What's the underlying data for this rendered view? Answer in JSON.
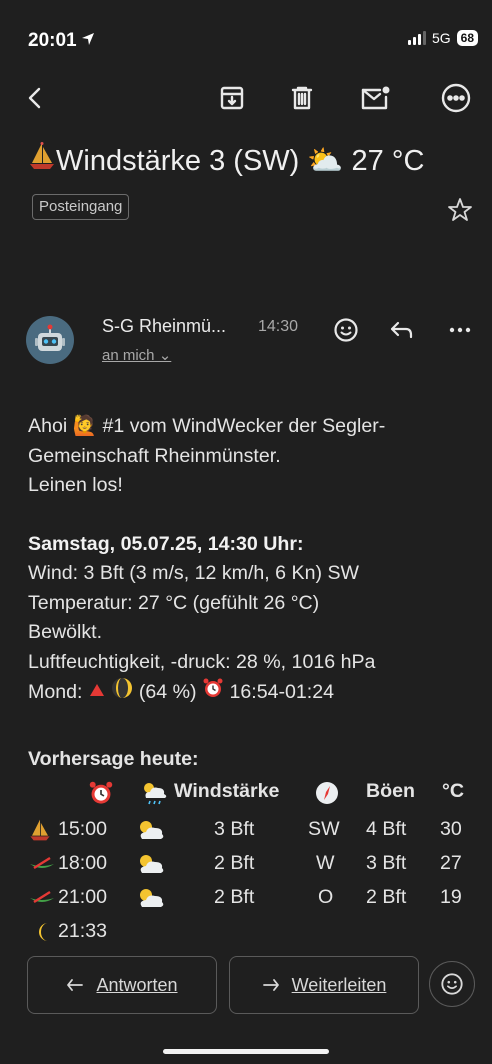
{
  "status": {
    "time": "20:01",
    "network": "5G",
    "battery": "68"
  },
  "subject": {
    "text": "Windstärke 3 (SW) ⛅ 27 °C",
    "label": "Posteingang"
  },
  "sender": {
    "name": "S-G Rheinmü...",
    "time": "14:30",
    "recipient": "an mich"
  },
  "body": {
    "line1": "Ahoi 🙋 #1 vom WindWecker der Segler-",
    "line2": "Gemeinschaft Rheinmünster.",
    "line3": "Leinen los!",
    "heading": "Samstag, 05.07.25, 14:30 Uhr:",
    "wind": "Wind: 3 Bft (3 m/s, 12 km/h, 6 Kn) SW",
    "temp": "Temperatur: 27 °C (gefühlt 26 °C)",
    "sky": "Bewölkt.",
    "humidity": "Luftfeuchtigkeit, -druck: 28 %, 1016 hPa",
    "moon_label": "Mond:",
    "moon_pct": "(64 %)",
    "moon_time": "16:54-01:24"
  },
  "forecast": {
    "heading": "Vorhersage heute:",
    "headers": {
      "wind": "Windstärke",
      "gust": "Böen",
      "temp": "°C"
    },
    "rows": [
      {
        "icon": "sailboat",
        "time": "15:00",
        "wind": "3 Bft",
        "dir": "SW",
        "gust": "4 Bft",
        "temp": "30"
      },
      {
        "icon": "canoe",
        "time": "18:00",
        "wind": "2 Bft",
        "dir": "W",
        "gust": "3 Bft",
        "temp": "27"
      },
      {
        "icon": "canoe",
        "time": "21:00",
        "wind": "2 Bft",
        "dir": "O",
        "gust": "2 Bft",
        "temp": "19"
      }
    ],
    "sunset": "21:33"
  },
  "actions": {
    "reply": "Antworten",
    "forward": "Weiterleiten"
  },
  "icons": [
    "back-icon",
    "archive-icon",
    "trash-icon",
    "mark-unread-icon",
    "more-icon",
    "star-icon",
    "emoji-icon",
    "reply-icon"
  ]
}
